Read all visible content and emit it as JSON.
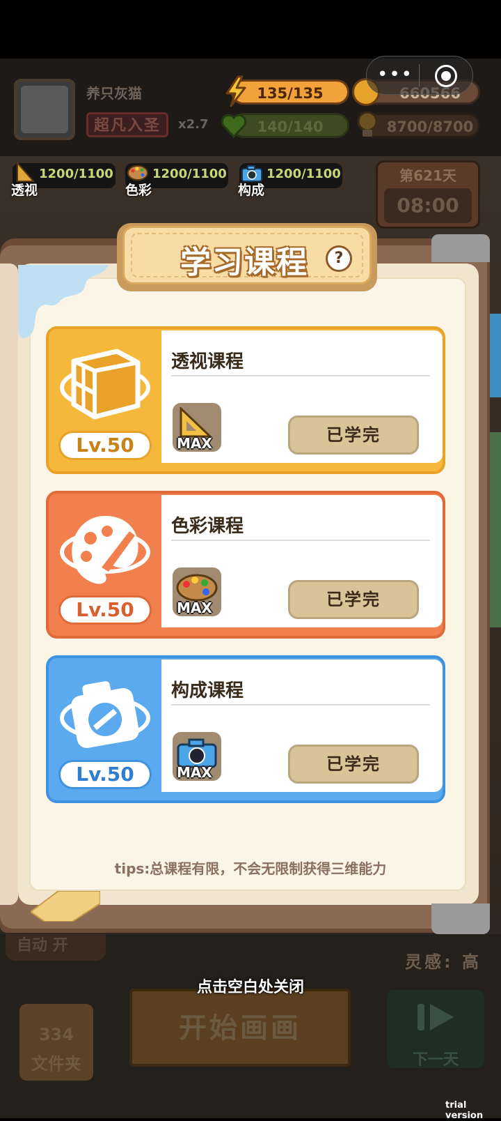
{
  "player": {
    "name": "养只灰猫",
    "rank": "超凡入圣",
    "multiplier": "x2.7"
  },
  "resources": {
    "energy": "135/135",
    "coins": "660566",
    "health": "140/140",
    "inspiration_points": "8700/8700"
  },
  "attributes": [
    {
      "label": "透视",
      "value": "1200/1100",
      "icon": "ruler-icon"
    },
    {
      "label": "色彩",
      "value": "1200/1100",
      "icon": "palette-icon"
    },
    {
      "label": "构成",
      "value": "1200/1100",
      "icon": "camera-icon"
    }
  ],
  "day": {
    "title": "第621天",
    "time": "08:00"
  },
  "panel": {
    "title": "学习课程",
    "help": "?",
    "tips": "tips:总课程有限，不会无限制获得三维能力"
  },
  "courses": [
    {
      "name": "透视课程",
      "level": "Lv.50",
      "badge": "MAX",
      "status": "已学完",
      "color": "#f4b63a",
      "icon": "cube-icon"
    },
    {
      "name": "色彩课程",
      "level": "Lv.50",
      "badge": "MAX",
      "status": "已学完",
      "color": "#f07f4e",
      "icon": "palette-icon"
    },
    {
      "name": "构成课程",
      "level": "Lv.50",
      "badge": "MAX",
      "status": "已学完",
      "color": "#5aa8ee",
      "icon": "camera-icon"
    }
  ],
  "background": {
    "auto": "自动 开",
    "inspiration_label": "灵感: 高",
    "folder_count": "334",
    "folder_label": "文件夹",
    "start_label": "开始画画",
    "next_label": "下一天"
  },
  "close_hint": "点击空白处关闭",
  "watermark": "trial version"
}
